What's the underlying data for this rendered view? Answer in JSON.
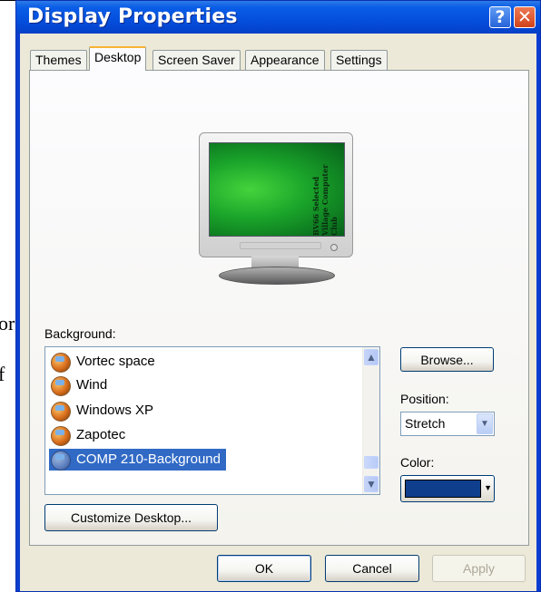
{
  "background_text": {
    "frag1": "or",
    "frag2": "f"
  },
  "window": {
    "title": "Display Properties",
    "help_button": "?",
    "close_button": "✕"
  },
  "tabs": [
    {
      "label": "Themes",
      "active": false
    },
    {
      "label": "Desktop",
      "active": true
    },
    {
      "label": "Screen Saver",
      "active": false
    },
    {
      "label": "Appearance",
      "active": false
    },
    {
      "label": "Settings",
      "active": false
    }
  ],
  "preview": {
    "screen_text": "BV66 Selected Village Computer Club"
  },
  "background": {
    "label": "Background:",
    "items": [
      {
        "label": "Vortec space",
        "selected": false
      },
      {
        "label": "Wind",
        "selected": false
      },
      {
        "label": "Windows XP",
        "selected": false
      },
      {
        "label": "Zapotec",
        "selected": false
      },
      {
        "label": "COMP 210-Background",
        "selected": true
      }
    ],
    "scroll_up_icon": "chevron-up-icon",
    "scroll_down_icon": "chevron-down-icon"
  },
  "side": {
    "browse_label": "Browse...",
    "position_label": "Position:",
    "position_value": "Stretch",
    "color_label": "Color:",
    "color_value": "#0f3f8c"
  },
  "customize_label": "Customize Desktop...",
  "footer": {
    "ok_label": "OK",
    "cancel_label": "Cancel",
    "apply_label": "Apply"
  }
}
